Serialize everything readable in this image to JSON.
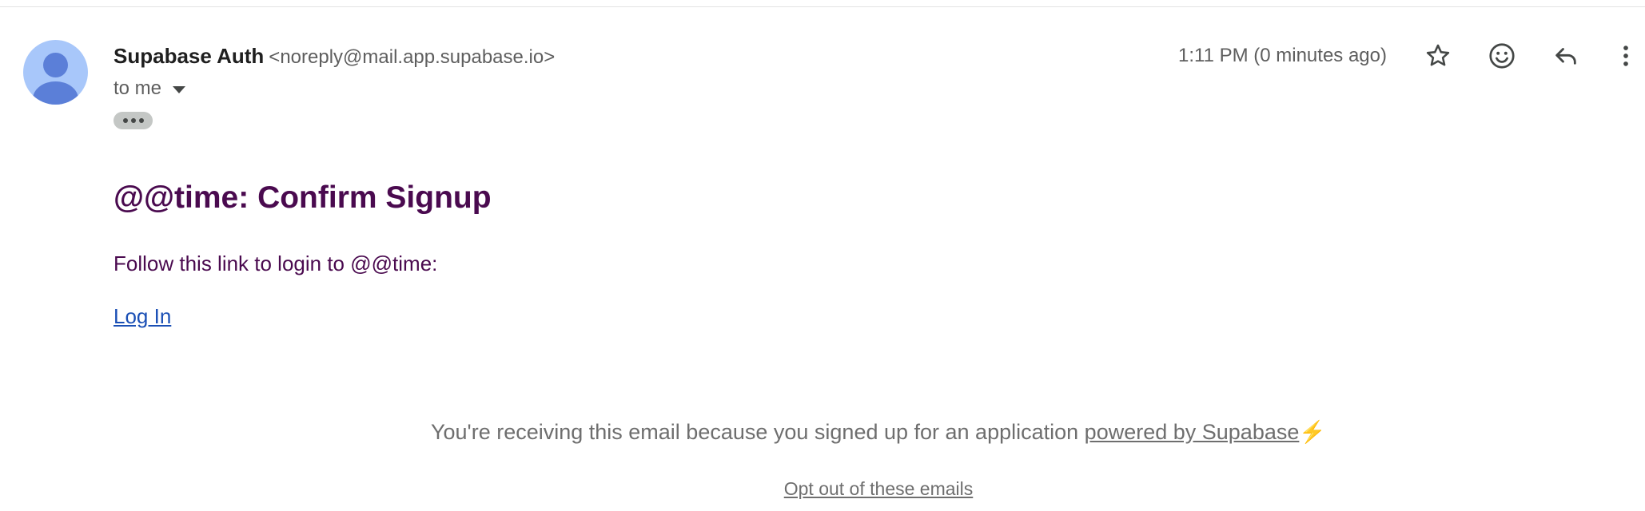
{
  "sender": {
    "name": "Supabase Auth",
    "email": "<noreply@mail.app.supabase.io>",
    "recipient_label": "to me",
    "avatar_icon": "person-avatar-icon",
    "avatar_colors": {
      "background": "#a8c7fa",
      "figure": "#5b7fd8"
    }
  },
  "header": {
    "timestamp": "1:11 PM (0 minutes ago)",
    "actions": [
      {
        "name": "star-icon",
        "label": "Star"
      },
      {
        "name": "emoji-icon",
        "label": "Add reaction"
      },
      {
        "name": "reply-icon",
        "label": "Reply"
      },
      {
        "name": "more-vert-icon",
        "label": "More"
      }
    ]
  },
  "email": {
    "title": "@@time: Confirm Signup",
    "body_text": "Follow this link to login to @@time:",
    "link_label": "Log In",
    "title_color": "#4a0a4f",
    "link_color": "#1a4fb5"
  },
  "footer": {
    "notice": "You're receiving this email because you signed up for an application",
    "powered_label": "powered by Supabase",
    "bolt": "⚡",
    "optout_label": "Opt out of these emails"
  }
}
